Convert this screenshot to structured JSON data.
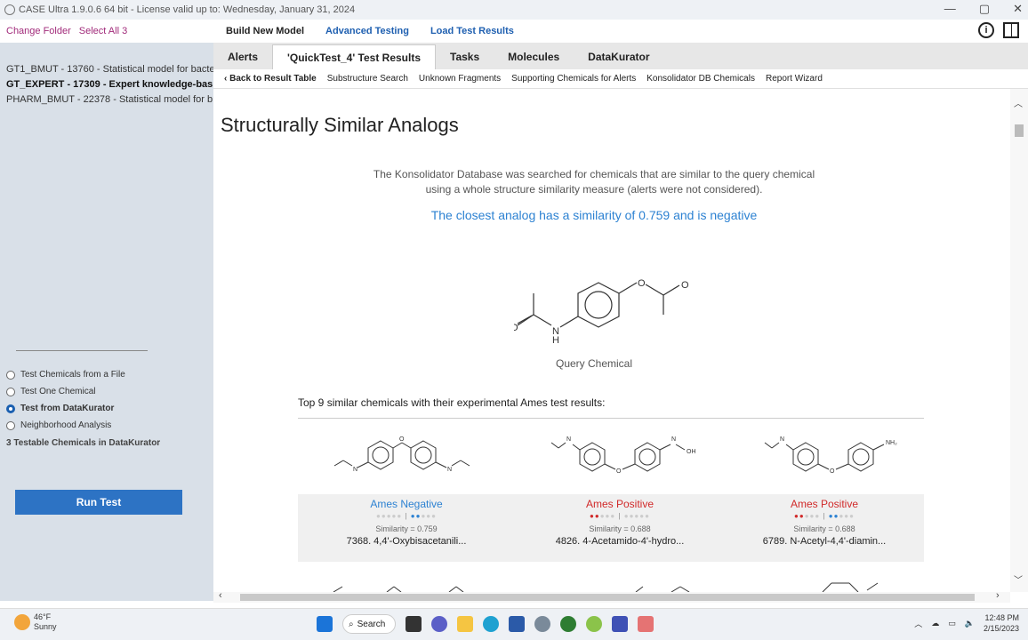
{
  "titlebar": {
    "title": "CASE Ultra 1.9.0.6 64 bit  - License valid up to: Wednesday, January 31, 2024",
    "min": "—",
    "max": "▢",
    "close": "✕"
  },
  "sidebar": {
    "change_folder": "Change Folder",
    "select_all": "Select All 3",
    "models": [
      "GT1_BMUT - 13760 - Statistical model for bacte",
      "GT_EXPERT - 17309 - Expert knowledge-bas",
      "PHARM_BMUT - 22378 - Statistical model for b"
    ],
    "options": [
      "Test Chemicals from a File",
      "Test One Chemical",
      "Test from DataKurator",
      "Neighborhood Analysis"
    ],
    "testable": "3 Testable Chemicals in DataKurator",
    "run_test": "Run Test"
  },
  "topnav": {
    "build": "Build New Model",
    "advanced": "Advanced Testing",
    "load": "Load Test Results"
  },
  "tabs": [
    "Alerts",
    "'QuickTest_4' Test Results",
    "Tasks",
    "Molecules",
    "DataKurator"
  ],
  "subnav": {
    "back": "‹  Back to Result Table",
    "items": [
      "Substructure Search",
      "Unknown Fragments",
      "Supporting Chemicals for Alerts",
      "Konsolidator DB Chemicals",
      "Report Wizard"
    ]
  },
  "content": {
    "heading": "Structurally Similar Analogs",
    "desc1": "The Konsolidator Database was searched for chemicals that are similar to the query chemical",
    "desc2": "using a whole structure similarity measure (alerts were not considered).",
    "closest": "The closest analog has a similarity of 0.759 and is negative",
    "query_label": "Query Chemical",
    "top9": "Top 9 similar chemicals with their experimental Ames test results:",
    "cards": [
      {
        "result": "Ames Negative",
        "similarity": "Similarity = 0.759",
        "name": "7368. 4,4'-Oxybisacetanili..."
      },
      {
        "result": "Ames Positive",
        "similarity": "Similarity = 0.688",
        "name": "4826. 4-Acetamido-4'-hydro..."
      },
      {
        "result": "Ames Positive",
        "similarity": "Similarity = 0.688",
        "name": "6789. N-Acetyl-4,4'-diamin..."
      }
    ]
  },
  "taskbar": {
    "temp": "46°F",
    "cond": "Sunny",
    "search": "Search",
    "time": "12:48 PM",
    "date": "2/15/2023"
  }
}
